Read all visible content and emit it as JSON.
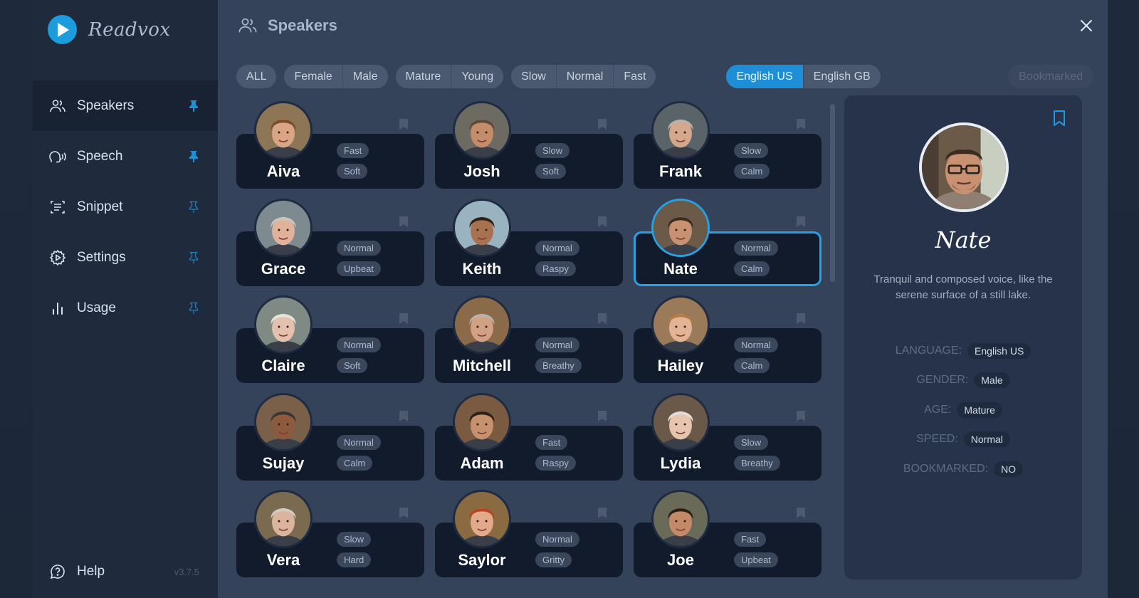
{
  "app": {
    "name": "Readvox",
    "version": "v3.7.5"
  },
  "sidebar": {
    "items": [
      {
        "label": "Speakers",
        "icon": "users-icon",
        "pinned": true,
        "active": true
      },
      {
        "label": "Speech",
        "icon": "speaking-head-icon",
        "pinned": true,
        "active": false
      },
      {
        "label": "Snippet",
        "icon": "text-scan-icon",
        "pinned": false,
        "active": false
      },
      {
        "label": "Settings",
        "icon": "gear-icon",
        "pinned": false,
        "active": false
      },
      {
        "label": "Usage",
        "icon": "bar-chart-icon",
        "pinned": false,
        "active": false
      }
    ],
    "help_label": "Help"
  },
  "header": {
    "title": "Speakers",
    "close_icon": "close-icon"
  },
  "filters": {
    "all": "ALL",
    "gender": [
      "Female",
      "Male"
    ],
    "age": [
      "Mature",
      "Young"
    ],
    "speed": [
      "Slow",
      "Normal",
      "Fast"
    ],
    "language": [
      {
        "label": "English US",
        "selected": true
      },
      {
        "label": "English GB",
        "selected": false
      }
    ],
    "bookmarked": "Bookmarked"
  },
  "speakers": [
    {
      "name": "Aiva",
      "tags": [
        "Fast",
        "Soft"
      ],
      "selected": false
    },
    {
      "name": "Josh",
      "tags": [
        "Slow",
        "Soft"
      ],
      "selected": false
    },
    {
      "name": "Frank",
      "tags": [
        "Slow",
        "Calm"
      ],
      "selected": false
    },
    {
      "name": "Grace",
      "tags": [
        "Normal",
        "Upbeat"
      ],
      "selected": false
    },
    {
      "name": "Keith",
      "tags": [
        "Normal",
        "Raspy"
      ],
      "selected": false
    },
    {
      "name": "Nate",
      "tags": [
        "Normal",
        "Calm"
      ],
      "selected": true
    },
    {
      "name": "Claire",
      "tags": [
        "Normal",
        "Soft"
      ],
      "selected": false
    },
    {
      "name": "Mitchell",
      "tags": [
        "Normal",
        "Breathy"
      ],
      "selected": false
    },
    {
      "name": "Hailey",
      "tags": [
        "Normal",
        "Calm"
      ],
      "selected": false
    },
    {
      "name": "Sujay",
      "tags": [
        "Normal",
        "Calm"
      ],
      "selected": false
    },
    {
      "name": "Adam",
      "tags": [
        "Fast",
        "Raspy"
      ],
      "selected": false
    },
    {
      "name": "Lydia",
      "tags": [
        "Slow",
        "Breathy"
      ],
      "selected": false
    },
    {
      "name": "Vera",
      "tags": [
        "Slow",
        "Hard"
      ],
      "selected": false
    },
    {
      "name": "Saylor",
      "tags": [
        "Normal",
        "Gritty"
      ],
      "selected": false
    },
    {
      "name": "Joe",
      "tags": [
        "Fast",
        "Upbeat"
      ],
      "selected": false
    }
  ],
  "detail": {
    "name": "Nate",
    "description": "Tranquil and composed voice, like the serene surface of a still lake.",
    "properties": [
      {
        "label": "LANGUAGE:",
        "value": "English US"
      },
      {
        "label": "GENDER:",
        "value": "Male"
      },
      {
        "label": "AGE:",
        "value": "Mature"
      },
      {
        "label": "SPEED:",
        "value": "Normal"
      },
      {
        "label": "BOOKMARKED:",
        "value": "NO"
      }
    ]
  },
  "colors": {
    "accent": "#1e8fd6",
    "selected_border": "#2ba0e0",
    "card_bg": "#111b2c",
    "sidebar_bg": "#1f2a3d",
    "main_bg": "#34425a"
  }
}
